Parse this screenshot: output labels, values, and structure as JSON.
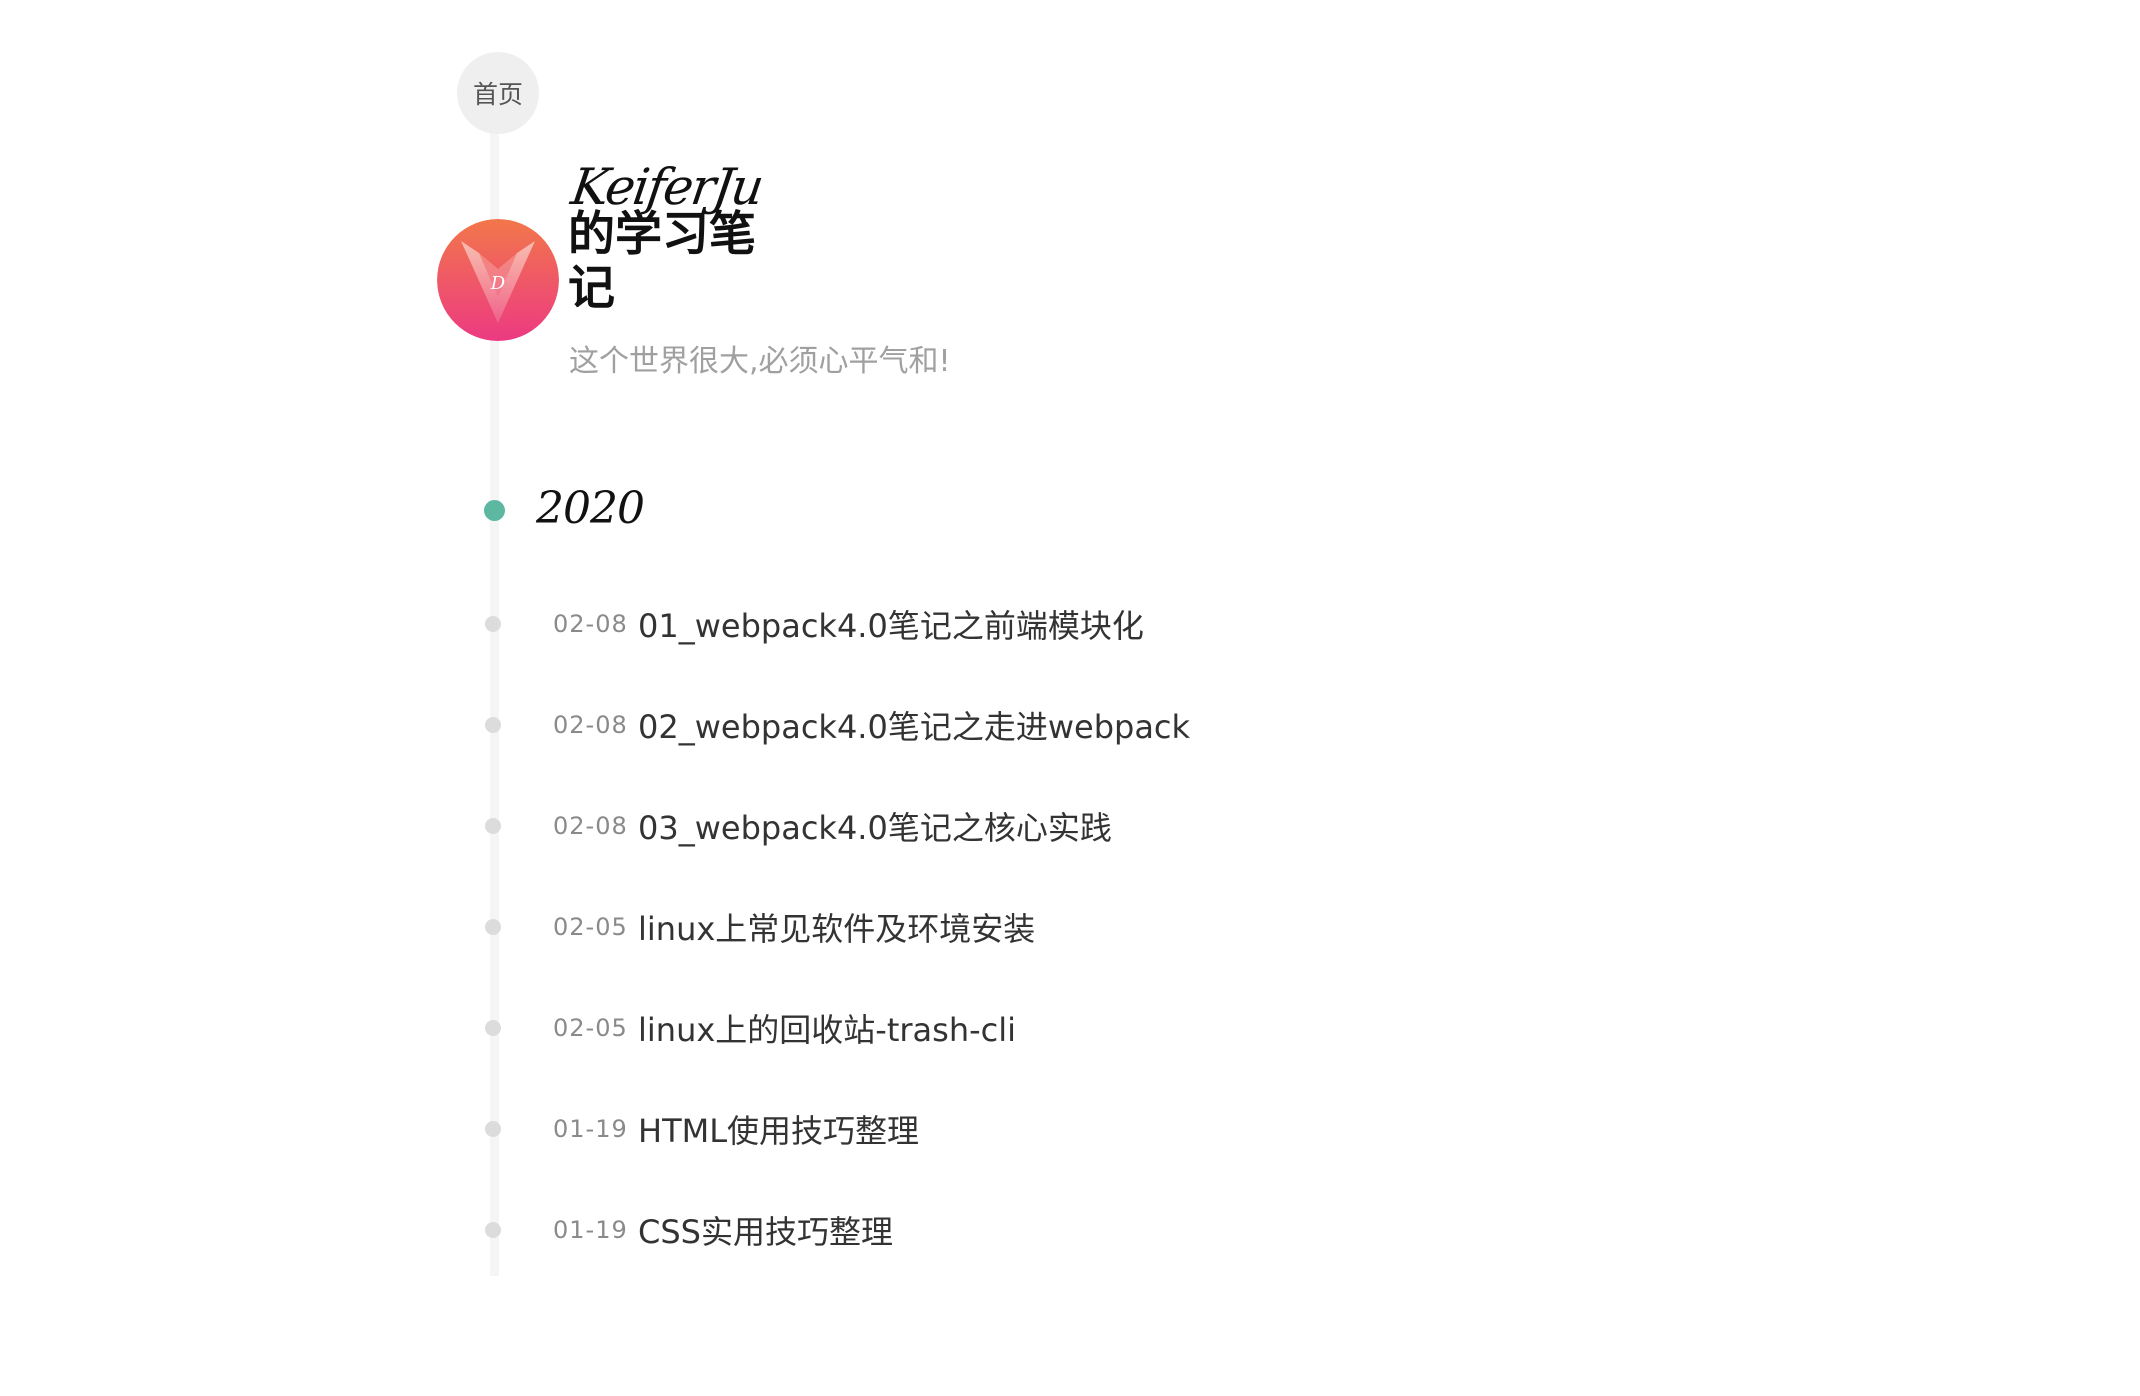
{
  "nav": {
    "home_label": "首页"
  },
  "blog": {
    "title_script": "KeiferJu",
    "title_cn": "的学习笔记",
    "tagline": "这个世界很大,必须心平气和!",
    "avatar_letter": "D"
  },
  "archive": {
    "year": "2020",
    "accent_color": "#5cb8a1",
    "posts": [
      {
        "date": "02-08",
        "title": "01_webpack4.0笔记之前端模块化"
      },
      {
        "date": "02-08",
        "title": "02_webpack4.0笔记之走进webpack"
      },
      {
        "date": "02-08",
        "title": "03_webpack4.0笔记之核心实践"
      },
      {
        "date": "02-05",
        "title": "linux上常见软件及环境安装"
      },
      {
        "date": "02-05",
        "title": "linux上的回收站-trash-cli"
      },
      {
        "date": "01-19",
        "title": "HTML使用技巧整理"
      },
      {
        "date": "01-19",
        "title": "CSS实用技巧整理"
      }
    ]
  }
}
